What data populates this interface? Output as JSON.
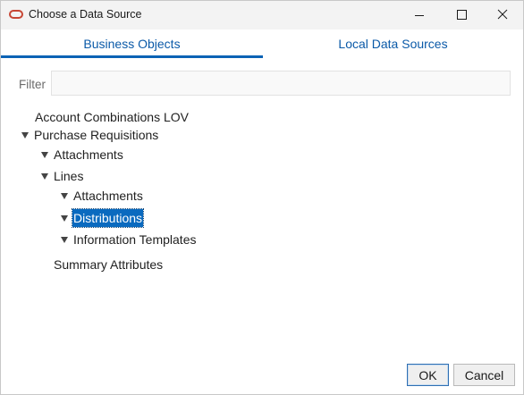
{
  "window": {
    "title": "Choose a Data Source"
  },
  "tabs": [
    {
      "label": "Business Objects",
      "active": true
    },
    {
      "label": "Local Data Sources",
      "active": false
    }
  ],
  "filter": {
    "label": "Filter",
    "value": "",
    "placeholder": ""
  },
  "tree": {
    "account_combinations": {
      "label": "Account Combinations LOV"
    },
    "purchase_requisitions": {
      "label": "Purchase Requisitions",
      "expanded": true
    },
    "pr_attachments": {
      "label": "Attachments",
      "expanded": true
    },
    "lines": {
      "label": "Lines",
      "expanded": true
    },
    "lines_attachments": {
      "label": "Attachments",
      "expanded": true
    },
    "distributions": {
      "label": "Distributions",
      "expanded": true,
      "selected": true
    },
    "information_templates": {
      "label": "Information Templates",
      "expanded": true
    },
    "summary_attributes": {
      "label": "Summary Attributes"
    }
  },
  "buttons": {
    "ok_label": "OK",
    "cancel_label": "Cancel"
  },
  "colors": {
    "accent": "#0a63b5",
    "selection": "#0a6abf",
    "app_icon": "#c74634"
  }
}
